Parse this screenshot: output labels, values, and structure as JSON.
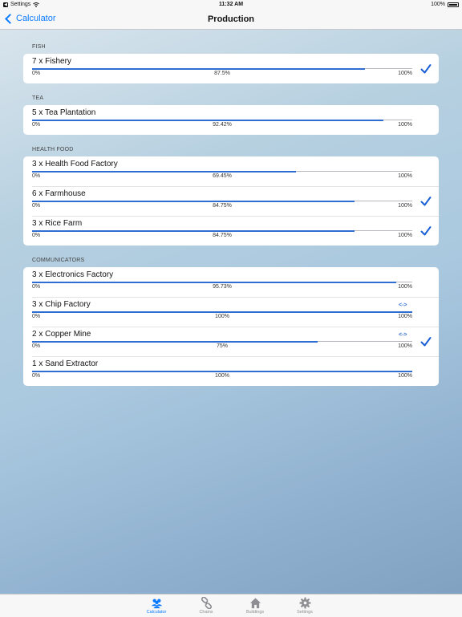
{
  "status_bar": {
    "carrier": "Settings",
    "time": "11:32 AM",
    "battery": "100%"
  },
  "nav": {
    "back_label": "Calculator",
    "title": "Production"
  },
  "sections": [
    {
      "header": "FISH",
      "rows": [
        {
          "title": "7 x Fishery",
          "min": "0%",
          "mid": "87.5%",
          "max": "100%",
          "fill": 0.875,
          "checked": true,
          "swap": ""
        }
      ]
    },
    {
      "header": "TEA",
      "rows": [
        {
          "title": "5 x Tea Plantation",
          "min": "0%",
          "mid": "92.42%",
          "max": "100%",
          "fill": 0.9242,
          "checked": false,
          "swap": ""
        }
      ]
    },
    {
      "header": "HEALTH FOOD",
      "rows": [
        {
          "title": "3 x Health Food Factory",
          "min": "0%",
          "mid": "69.45%",
          "max": "100%",
          "fill": 0.6945,
          "checked": false,
          "swap": ""
        },
        {
          "title": "6 x Farmhouse",
          "min": "0%",
          "mid": "84.75%",
          "max": "100%",
          "fill": 0.8475,
          "checked": true,
          "swap": ""
        },
        {
          "title": "3 x Rice Farm",
          "min": "0%",
          "mid": "84.75%",
          "max": "100%",
          "fill": 0.8475,
          "checked": true,
          "swap": ""
        }
      ]
    },
    {
      "header": "COMMUNICATORS",
      "rows": [
        {
          "title": "3 x Electronics Factory",
          "min": "0%",
          "mid": "95.73%",
          "max": "100%",
          "fill": 0.9573,
          "checked": false,
          "swap": ""
        },
        {
          "title": "3 x Chip Factory",
          "min": "0%",
          "mid": "100%",
          "max": "100%",
          "fill": 1.0,
          "checked": false,
          "swap": "<->"
        },
        {
          "title": "2 x Copper Mine",
          "min": "0%",
          "mid": "75%",
          "max": "100%",
          "fill": 0.75,
          "checked": true,
          "swap": "<->"
        },
        {
          "title": "1 x Sand Extractor",
          "min": "0%",
          "mid": "100%",
          "max": "100%",
          "fill": 1.0,
          "checked": false,
          "swap": ""
        }
      ]
    }
  ],
  "tabs": [
    {
      "label": "Calculator",
      "icon": "people-icon",
      "active": true
    },
    {
      "label": "Chains",
      "icon": "chain-link-icon",
      "active": false
    },
    {
      "label": "Buildings",
      "icon": "house-icon",
      "active": false
    },
    {
      "label": "Settings",
      "icon": "gear-icon",
      "active": false
    }
  ],
  "colors": {
    "accent": "#0a7aff",
    "progress": "#2e6dd1",
    "check": "#1a5fd6"
  }
}
